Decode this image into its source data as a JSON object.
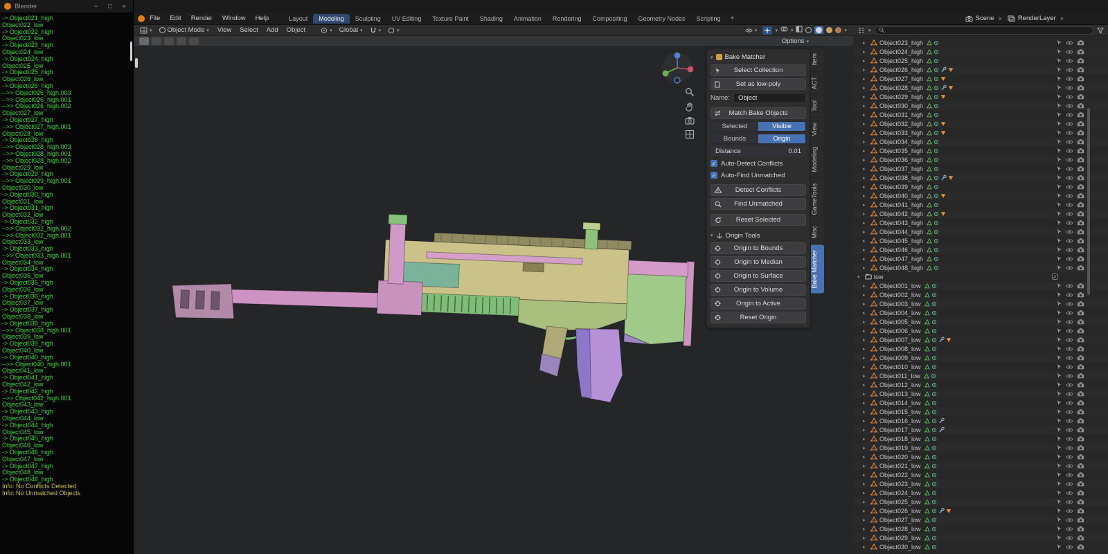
{
  "console_window": {
    "title": "Blender",
    "lines": [
      "-> Object021_high",
      "Object022_low",
      "-> Object022_high",
      "Object023_low",
      "-> Object023_high",
      "Object024_low",
      "-> Object024_high",
      "Object025_low",
      "-> Object025_high",
      "Object026_low",
      "-> Object026_high",
      "-->> Object026_high.003",
      "-->> Object026_high.001",
      "-->> Object026_high.002",
      "Object027_low",
      "-> Object027_high",
      "-->> Object027_high.001",
      "Object028_low",
      "-> Object028_high",
      "-->> Object028_high.003",
      "-->> Object028_high.001",
      "-->> Object028_high.002",
      "Object029_low",
      "-> Object029_high",
      "-->> Object029_high.001",
      "Object030_low",
      "-> Object030_high",
      "Object031_low",
      "-> Object031_high",
      "Object032_low",
      "-> Object032_high",
      "-->> Object032_high.002",
      "-->> Object032_high.001",
      "Object033_low",
      "-> Object033_high",
      "-->> Object033_high.001",
      "Object034_low",
      "-> Object034_high",
      "Object035_low",
      "-> Object035_high",
      "Object036_low",
      "-> Object036_high",
      "Object037_low",
      "-> Object037_high",
      "Object038_low",
      "-> Object038_high",
      "-->> Object038_high.001",
      "Object039_low",
      "-> Object039_high",
      "Object040_low",
      "-> Object040_high",
      "-->> Object040_high.001",
      "Object041_low",
      "-> Object041_high",
      "Object042_low",
      "-> Object042_high",
      "-->> Object042_high.001",
      "Object043_low",
      "-> Object043_high",
      "Object044_low",
      "-> Object044_high",
      "Object045_low",
      "-> Object045_high",
      "Object046_low",
      "-> Object046_high",
      "Object047_low",
      "-> Object047_high",
      "Object048_low",
      "-> Object048_high",
      "Info: No Conflicts Detected",
      "Info: No Unmatched Objects"
    ]
  },
  "topbar": {
    "menus": [
      "File",
      "Edit",
      "Render",
      "Window",
      "Help"
    ],
    "tabs": [
      "Layout",
      "Modeling",
      "Sculpting",
      "UV Editing",
      "Texture Paint",
      "Shading",
      "Animation",
      "Rendering",
      "Compositing",
      "Geometry Nodes",
      "Scripting"
    ],
    "active_tab": "Modeling",
    "add_tab": "+",
    "scene": "Scene",
    "view_layer": "RenderLayer"
  },
  "viewport_header": {
    "mode": "Object Mode",
    "menus": [
      "View",
      "Select",
      "Add",
      "Object"
    ],
    "orientation": "Global"
  },
  "tool_settings": {
    "options": "Options"
  },
  "panel": {
    "title": "Bake Matcher",
    "select_collection": "Select Collection",
    "set_low_poly": "Set as low-poly",
    "name_label": "Name:",
    "name_value": "Object",
    "match_bake": "Match Bake Objects",
    "match_mode": {
      "left": "Selected",
      "right": "Visible"
    },
    "origin_mode": {
      "left": "Bounds",
      "right": "Origin"
    },
    "distance_label": "Distance",
    "distance_value": "0.01",
    "auto_detect": "Auto-Detect Conflicts",
    "auto_find": "Auto-Find Unmatched",
    "detect_conflicts": "Detect Conflicts",
    "find_unmatched": "Find Unmatched",
    "reset_selected": "Reset Selected",
    "origin_tools": "Origin Tools",
    "origin_buttons": [
      "Origin to Bounds",
      "Origin to Median",
      "Origin to Surface",
      "Origin to Volume",
      "Origin to Active",
      "Reset Origin"
    ]
  },
  "side_tabs": {
    "items": [
      "Item",
      "ACT",
      "Tool",
      "View",
      "Modeling",
      "GameTools",
      "Misc",
      "Bake Matcher"
    ],
    "active": "Bake Matcher"
  },
  "outliner": {
    "low_collection": "low",
    "high_items": [
      {
        "n": "Object023_high"
      },
      {
        "n": "Object024_high"
      },
      {
        "n": "Object025_high"
      },
      {
        "n": "Object026_high",
        "w": 1,
        "o": 1
      },
      {
        "n": "Object027_high",
        "o": 1
      },
      {
        "n": "Object028_high",
        "w": 1,
        "o": 1
      },
      {
        "n": "Object029_high",
        "o": 1
      },
      {
        "n": "Object030_high"
      },
      {
        "n": "Object031_high"
      },
      {
        "n": "Object032_high",
        "o": 1
      },
      {
        "n": "Object033_high",
        "o": 1
      },
      {
        "n": "Object034_high"
      },
      {
        "n": "Object035_high"
      },
      {
        "n": "Object036_high"
      },
      {
        "n": "Object037_high"
      },
      {
        "n": "Object038_high",
        "w": 1,
        "o": 1
      },
      {
        "n": "Object039_high"
      },
      {
        "n": "Object040_high",
        "o": 1
      },
      {
        "n": "Object041_high"
      },
      {
        "n": "Object042_high",
        "o": 1
      },
      {
        "n": "Object043_high"
      },
      {
        "n": "Object044_high"
      },
      {
        "n": "Object045_high"
      },
      {
        "n": "Object046_high"
      },
      {
        "n": "Object047_high"
      },
      {
        "n": "Object048_high"
      }
    ],
    "low_items": [
      {
        "n": "Object001_low"
      },
      {
        "n": "Object002_low"
      },
      {
        "n": "Object003_low"
      },
      {
        "n": "Object004_low"
      },
      {
        "n": "Object005_low"
      },
      {
        "n": "Object006_low"
      },
      {
        "n": "Object007_low",
        "w": 1,
        "o": 1
      },
      {
        "n": "Object008_low"
      },
      {
        "n": "Object009_low"
      },
      {
        "n": "Object010_low"
      },
      {
        "n": "Object011_low"
      },
      {
        "n": "Object012_low"
      },
      {
        "n": "Object013_low"
      },
      {
        "n": "Object014_low"
      },
      {
        "n": "Object015_low"
      },
      {
        "n": "Object016_low",
        "w": 1
      },
      {
        "n": "Object017_low",
        "w": 1
      },
      {
        "n": "Object018_low"
      },
      {
        "n": "Object019_low"
      },
      {
        "n": "Object020_low"
      },
      {
        "n": "Object021_low"
      },
      {
        "n": "Object022_low"
      },
      {
        "n": "Object023_low"
      },
      {
        "n": "Object024_low"
      },
      {
        "n": "Object025_low"
      },
      {
        "n": "Object026_low",
        "w": 1,
        "o": 1
      },
      {
        "n": "Object027_low"
      },
      {
        "n": "Object028_low"
      },
      {
        "n": "Object029_low"
      },
      {
        "n": "Object030_low"
      }
    ]
  }
}
